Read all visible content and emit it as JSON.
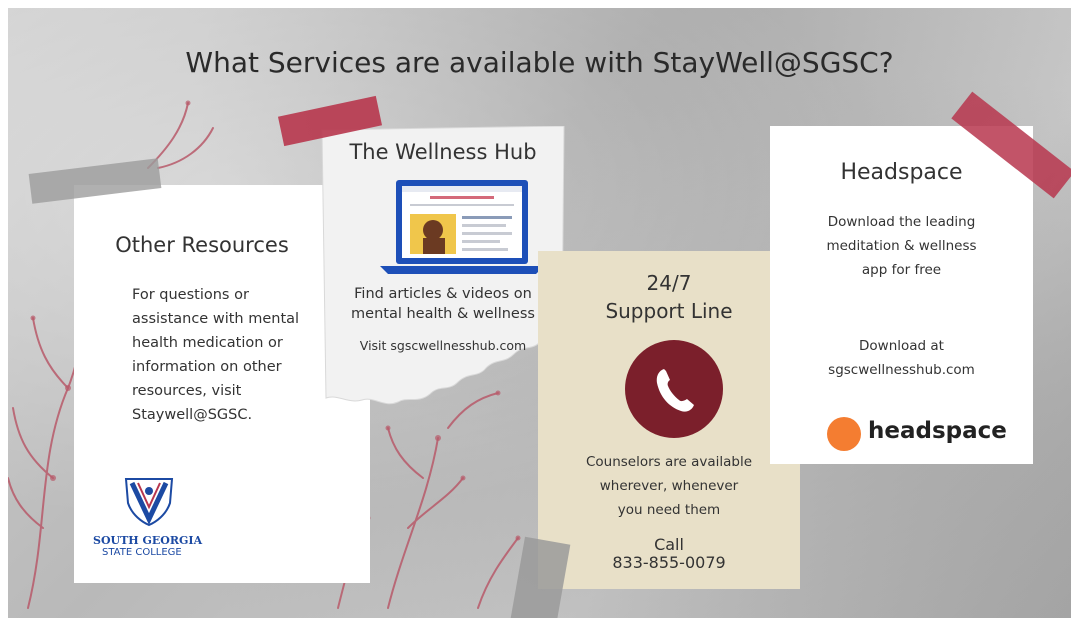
{
  "page": {
    "title": "What Services are available with StayWell@SGSC?"
  },
  "other_resources": {
    "title": "Other Resources",
    "lines": [
      "For questions or",
      "assistance with mental",
      "health medication or",
      "information on other",
      "resources, visit",
      "Staywell@SGSC."
    ],
    "logo": {
      "name": "sgsc-shield-logo",
      "line1": "SOUTH GEORGIA",
      "line2": "STATE COLLEGE"
    }
  },
  "wellness_hub": {
    "title": "The Wellness Hub",
    "line1": "Find articles & videos on",
    "line2": "mental health & wellness",
    "visit": "Visit sgscwellnesshub.com"
  },
  "support_line": {
    "title_line1": "24/7",
    "title_line2": "Support Line",
    "lines": [
      "Counselors are available",
      "wherever, whenever",
      "you need them"
    ],
    "call_label": "Call",
    "phone": "833-855-0079"
  },
  "headspace": {
    "title": "Headspace",
    "lines": [
      "Download the leading",
      "meditation & wellness",
      "app for free"
    ],
    "download_label": "Download at",
    "url": "sgscwellnesshub.com",
    "logo_word": "headspace"
  },
  "colors": {
    "tape_red": "#b7364d",
    "tape_gray": "#9a9a9a",
    "phone_circle": "#7b1f2b",
    "headspace_orange": "#f47d31",
    "sgsc_blue": "#1c4aa3",
    "coral": "#b85a6a"
  }
}
